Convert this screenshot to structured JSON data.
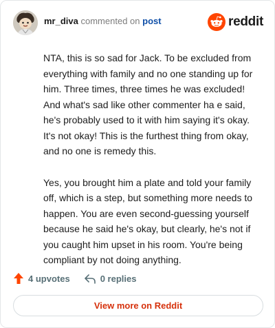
{
  "comment": {
    "username": "mr_diva",
    "commented_text": "commented on",
    "post_link_text": "post",
    "brand": "reddit",
    "paragraphs": [
      "NTA, this is so sad for Jack. To be excluded from everything with family and no one standing up for him. Three times, three times he was excluded! And what's sad like other commenter ha e said, he's probably used to it with him saying it's okay. It's not okay! This is the furthest thing from okay, and no one is remedy this.",
      "Yes, you brought him a plate and told your family off, which is a step, but something more needs to happen. You are even second-guessing yourself because he said he's okay, but clearly, he's not if you caught him upset in his room. You're being compliant by not doing anything."
    ],
    "upvotes_label": "4 upvotes",
    "replies_label": "0 replies",
    "view_more_label": "View more on Reddit"
  },
  "colors": {
    "reddit_orange": "#ff4500",
    "upvote_orange": "#ff4500",
    "link_blue": "#0f4fa8",
    "view_more_text": "#d6310c",
    "muted": "#576f76"
  },
  "icons": {
    "avatar": "cartoon-user-avatar",
    "brand": "reddit-snoo-icon",
    "upvote": "upvote-arrow-icon",
    "reply": "reply-arrow-icon"
  }
}
